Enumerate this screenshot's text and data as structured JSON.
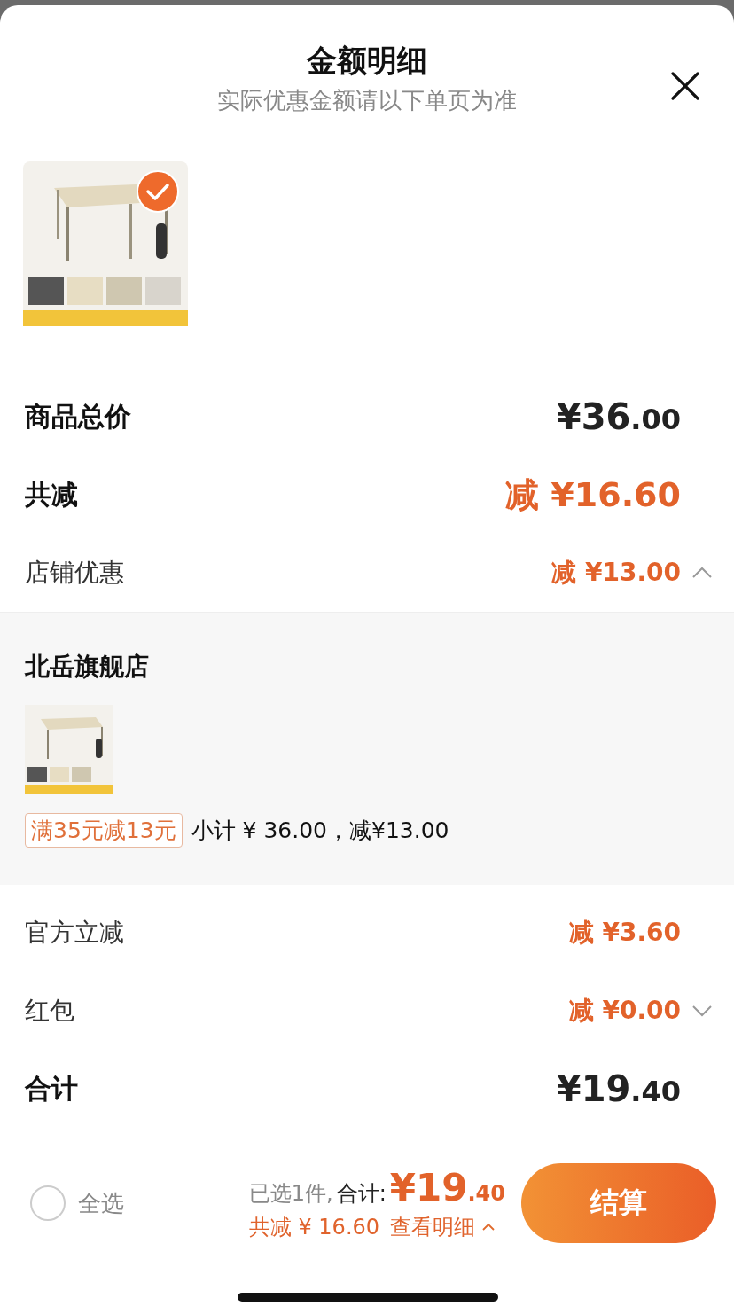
{
  "header": {
    "title": "金额明细",
    "subtitle": "实际优惠金额请以下单页为准"
  },
  "product": {
    "selected": true
  },
  "rows": [
    {
      "kind": "total",
      "label": "商品总价",
      "amount": "¥36.00"
    },
    {
      "kind": "discount",
      "label": "共减",
      "amount": "减 ¥16.60"
    },
    {
      "kind": "sub",
      "label": "店铺优惠",
      "amount": "减 ¥13.00",
      "expanded": true,
      "store": {
        "name": "北岳旗舰店",
        "promo_tag": "满35元减13元",
        "subtotal": "小计 ¥ 36.00，减¥13.00"
      }
    },
    {
      "kind": "sub",
      "label": "官方立减",
      "amount": "减 ¥3.60"
    },
    {
      "kind": "sub",
      "label": "红包",
      "amount": "减 ¥0.00",
      "expanded": false
    },
    {
      "kind": "total",
      "label": "合计",
      "amount": "¥19.40"
    }
  ],
  "bottom_bar": {
    "select_all": {
      "label": "全选",
      "checked": false
    },
    "selected_count": "已选1件,",
    "total_label": "合计:",
    "total": "¥19.40",
    "savings": "共减 ¥ 16.60",
    "details_link": "查看明细",
    "checkout": "结算"
  }
}
